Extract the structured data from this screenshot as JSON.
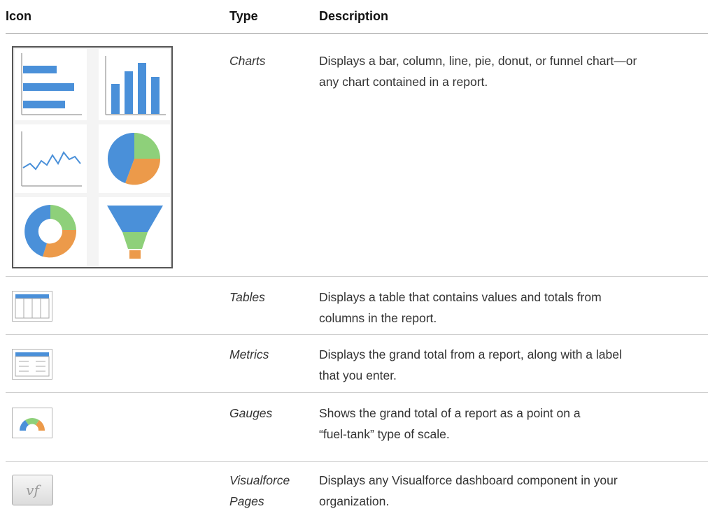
{
  "headers": {
    "icon": "Icon",
    "type": "Type",
    "description": "Description"
  },
  "rows": [
    {
      "type": "Charts",
      "description_lines": [
        "Displays a bar, column, line, pie, donut, or funnel chart—or",
        "any chart contained in a report."
      ],
      "icon": "charts-grid-icon"
    },
    {
      "type": "Tables",
      "description_lines": [
        "Displays a table that contains values and totals from",
        "columns in the report."
      ],
      "icon": "table-icon"
    },
    {
      "type": "Metrics",
      "description_lines": [
        "Displays the grand total from a report, along with a label",
        "that you enter."
      ],
      "icon": "metric-icon"
    },
    {
      "type": "Gauges",
      "description_lines": [
        "Shows the grand total of a report as a point on a",
        "“fuel-tank” type of scale."
      ],
      "icon": "gauge-icon"
    },
    {
      "type_lines": [
        "Visualforce",
        "Pages"
      ],
      "description_lines": [
        "Displays any Visualforce dashboard component in your",
        "organization."
      ],
      "icon": "visualforce-icon",
      "icon_text": "vf"
    }
  ],
  "colors": {
    "blue": "#4a90d9",
    "green": "#8ed07a",
    "orange": "#ec9a4a",
    "rule": "#cfcfcf"
  }
}
